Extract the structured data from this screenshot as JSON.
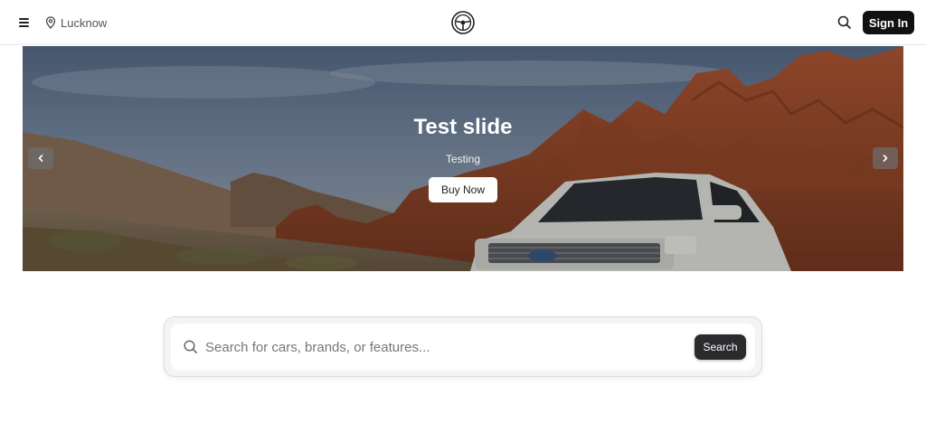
{
  "header": {
    "location": "Lucknow",
    "signin_label": "Sign In",
    "icons": {
      "menu": "menu-icon",
      "location": "map-pin-icon",
      "logo": "steering-wheel-logo",
      "search": "search-icon"
    }
  },
  "hero": {
    "title": "Test slide",
    "subtitle": "Testing",
    "cta_label": "Buy Now",
    "prev_icon": "chevron-left-icon",
    "next_icon": "chevron-right-icon"
  },
  "search": {
    "placeholder": "Search for cars, brands, or features...",
    "value": "",
    "button_label": "Search"
  },
  "colors": {
    "primary": "#111111",
    "search_button": "#2b2b2e"
  }
}
